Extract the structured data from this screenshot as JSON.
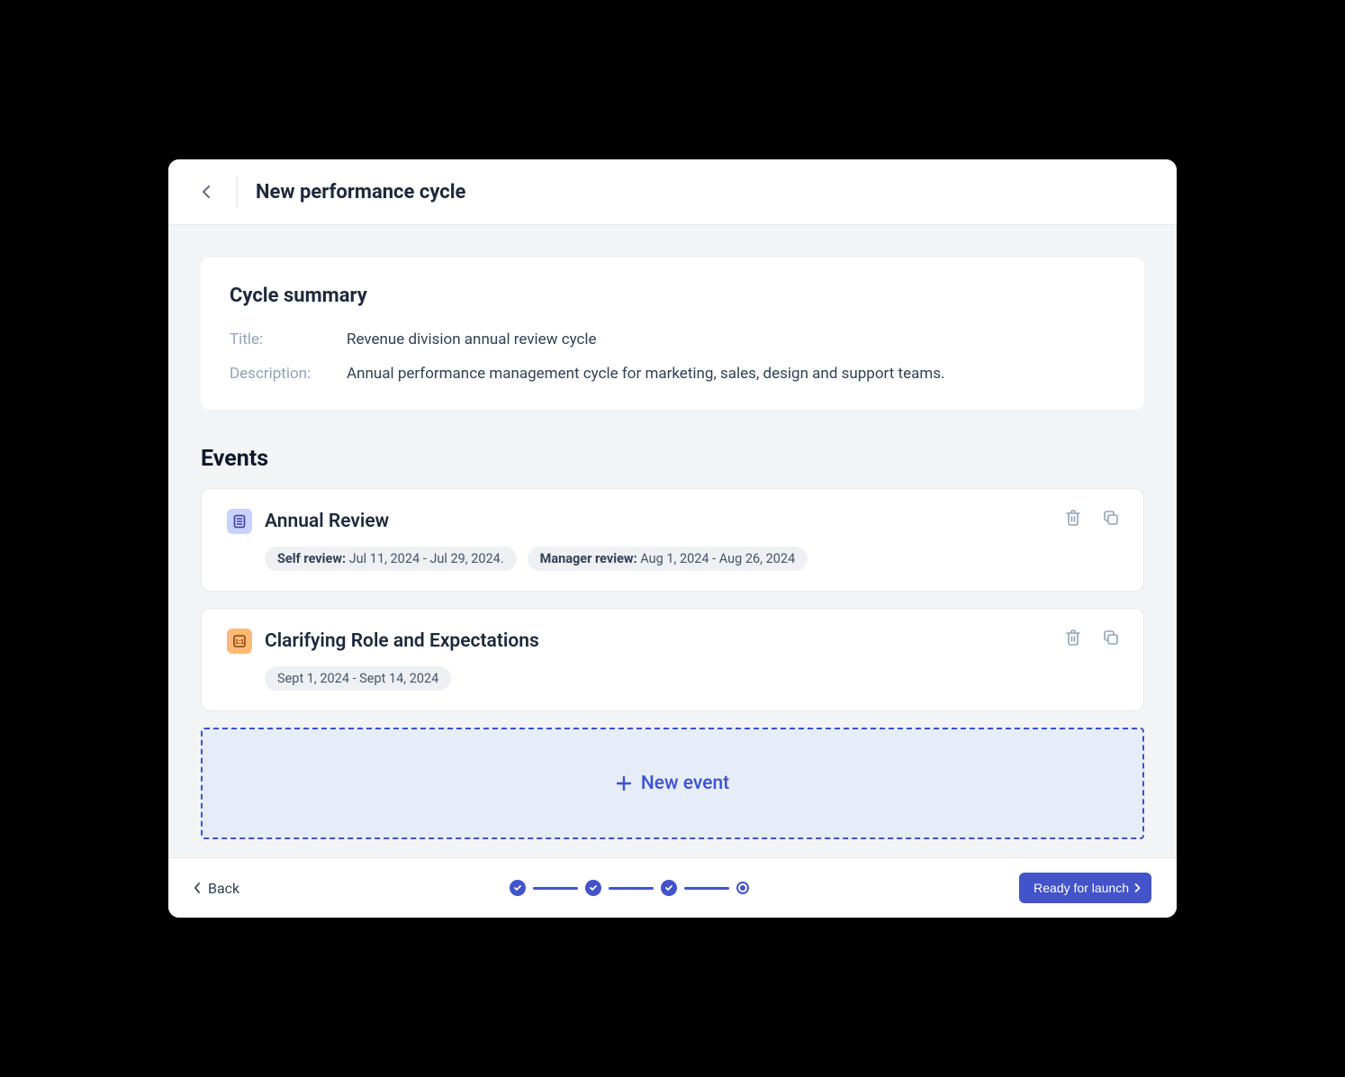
{
  "header": {
    "title": "New performance cycle"
  },
  "summary": {
    "heading": "Cycle summary",
    "title_label": "Title:",
    "title_value": "Revenue division annual review cycle",
    "description_label": "Description:",
    "description_value": "Annual performance management cycle for marketing, sales, design and support teams."
  },
  "events": {
    "heading": "Events",
    "items": [
      {
        "title": "Annual Review",
        "icon": "document",
        "icon_color": "blue",
        "pills": [
          {
            "label": "Self review:",
            "value": "Jul 11, 2024 - Jul 29, 2024."
          },
          {
            "label": "Manager review:",
            "value": "Aug 1, 2024 - Aug 26, 2024"
          }
        ]
      },
      {
        "title": "Clarifying Role and Expectations",
        "icon": "one-on-one",
        "icon_color": "orange",
        "pills": [
          {
            "label": "",
            "value": "Sept 1, 2024 - Sept 14, 2024"
          }
        ]
      }
    ],
    "new_event_label": "New event"
  },
  "footer": {
    "back_label": "Back",
    "launch_label": "Ready for launch",
    "steps": {
      "total": 4,
      "completed": 3
    }
  },
  "colors": {
    "primary": "#4353c9",
    "text_dark": "#1e293b",
    "text_muted": "#94a3b8"
  }
}
